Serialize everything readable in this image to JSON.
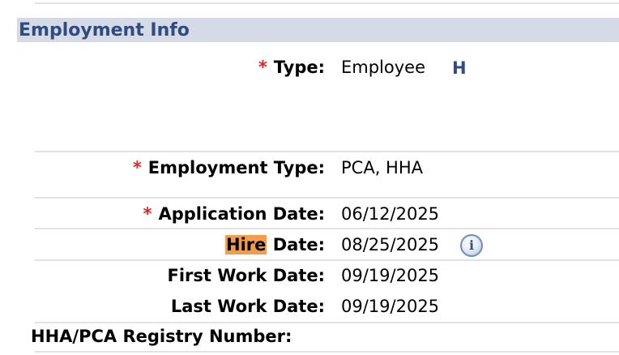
{
  "section": {
    "title": "Employment Info"
  },
  "fields": {
    "type": {
      "required": "*",
      "label": "Type:",
      "value": "Employee",
      "link": "H"
    },
    "employment_type": {
      "required": "*",
      "label": "Employment Type:",
      "value": "PCA, HHA"
    },
    "application_date": {
      "required": "*",
      "label": "Application Date:",
      "value": "06/12/2025"
    },
    "hire_date": {
      "label_highlight": "Hire",
      "label_rest": " Date:",
      "value": "08/25/2025",
      "info_icon_glyph": "i"
    },
    "first_work_date": {
      "label": "First Work Date:",
      "value": "09/19/2025"
    },
    "last_work_date": {
      "label": "Last Work Date:",
      "value": "09/19/2025"
    },
    "registry_number": {
      "label": "HHA/PCA Registry Number:",
      "value": ""
    }
  },
  "icons": {
    "info": "info-icon"
  },
  "colors": {
    "header_bg": "#d5dae6",
    "header_text": "#2e4b82",
    "required": "#e32424",
    "highlight": "#f39c4c"
  }
}
